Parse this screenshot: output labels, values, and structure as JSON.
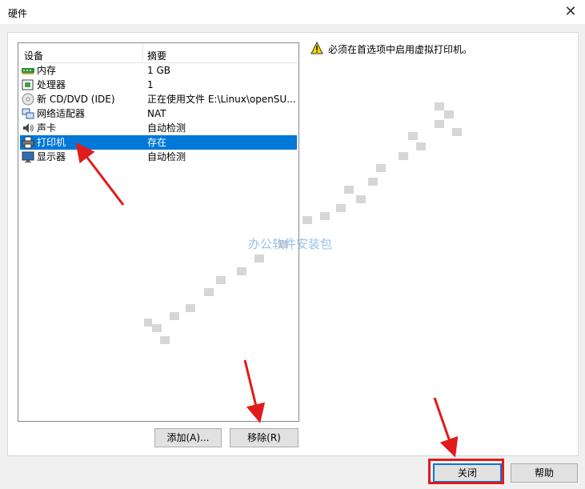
{
  "window": {
    "title": "硬件"
  },
  "list": {
    "columns": [
      "设备",
      "摘要"
    ],
    "rows": [
      {
        "name": "内存",
        "summary": "1 GB",
        "icon": "memory-icon"
      },
      {
        "name": "处理器",
        "summary": "1",
        "icon": "processor-icon"
      },
      {
        "name": "新 CD/DVD (IDE)",
        "summary": "正在使用文件 E:\\Linux\\openSU...",
        "icon": "cd-dvd-icon"
      },
      {
        "name": "网络适配器",
        "summary": "NAT",
        "icon": "network-adapter-icon"
      },
      {
        "name": "声卡",
        "summary": "自动检测",
        "icon": "sound-card-icon"
      },
      {
        "name": "打印机",
        "summary": "存在",
        "icon": "printer-icon",
        "selected": true
      },
      {
        "name": "显示器",
        "summary": "自动检测",
        "icon": "display-icon"
      }
    ]
  },
  "info": {
    "message": "必须在首选项中启用虚拟打印机。",
    "icon": "warning-icon"
  },
  "buttons": {
    "add": "添加(A)...",
    "remove": "移除(R)",
    "close": "关闭",
    "help": "帮助"
  },
  "watermark": "办公软件安装包",
  "colors": {
    "selection": "#0078d7",
    "annotation_red": "#e11b1b"
  }
}
